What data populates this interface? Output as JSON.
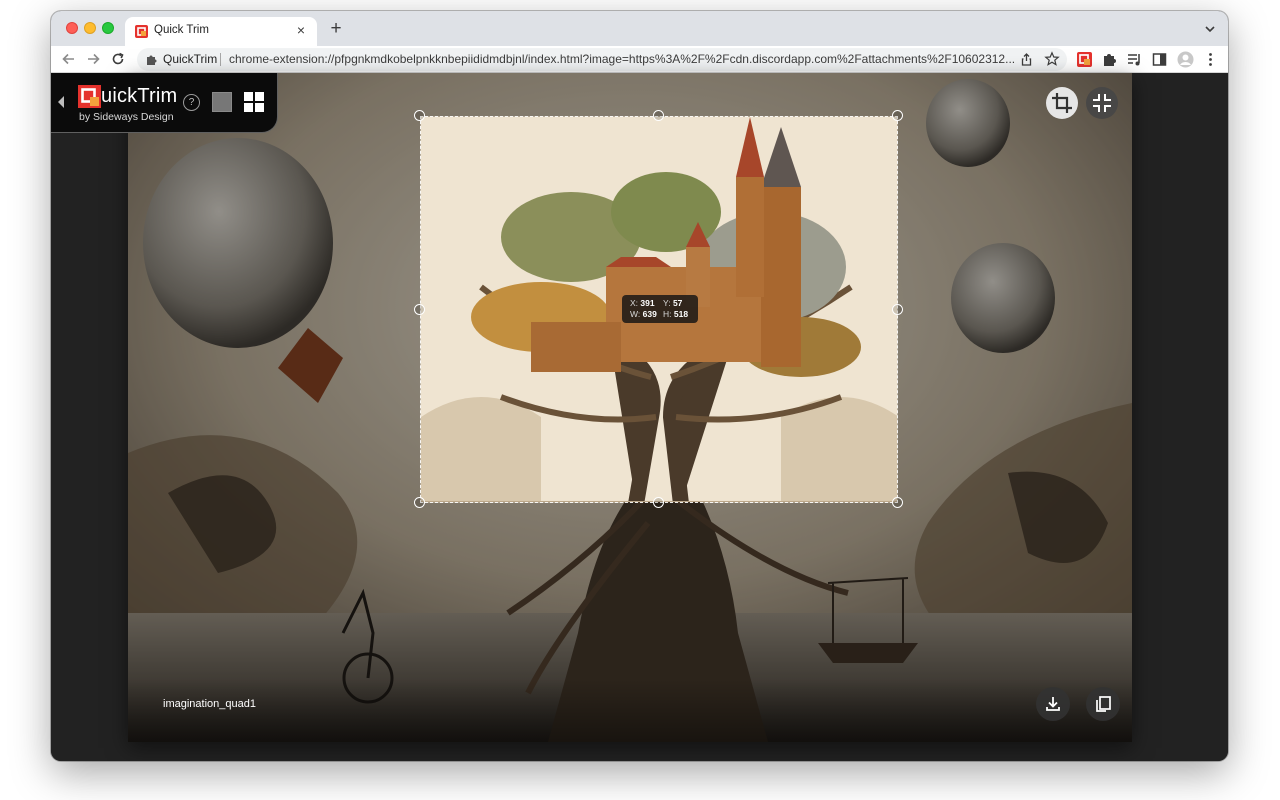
{
  "browser": {
    "tab": {
      "title": "Quick Trim",
      "close_symbol": "×",
      "favicon": "quicktrim-favicon-icon"
    },
    "new_tab_symbol": "+",
    "omnibox": {
      "site_name": "QuickTrim",
      "url": "chrome-extension://pfpgnkmdkobelpnkknbepiididmdbjnl/index.html?image=https%3A%2F%2Fcdn.discordapp.com%2Fattachments%2F10602312..."
    },
    "toolbar_icons": [
      "quicktrim-extension-icon",
      "extensions-puzzle-icon",
      "media-queue-icon",
      "side-panel-icon",
      "profile-avatar-icon",
      "menu-dots-icon"
    ]
  },
  "app": {
    "logo_letter": "Q",
    "logo_rest": "uickTrim",
    "byline": "by Sideways Design",
    "help_symbol": "?",
    "brand_color": "#e5322d",
    "brand_accent": "#f3a23c"
  },
  "selection": {
    "x_label": "X:",
    "x": "391",
    "y_label": "Y:",
    "y": "57",
    "w_label": "W:",
    "w": "639",
    "h_label": "H:",
    "h": "518"
  },
  "image": {
    "filename": "imagination_quad1"
  },
  "actions": {
    "crop": "crop-icon",
    "collapse": "collapse-arrows-icon",
    "download": "download-icon",
    "copy": "copy-icon"
  }
}
